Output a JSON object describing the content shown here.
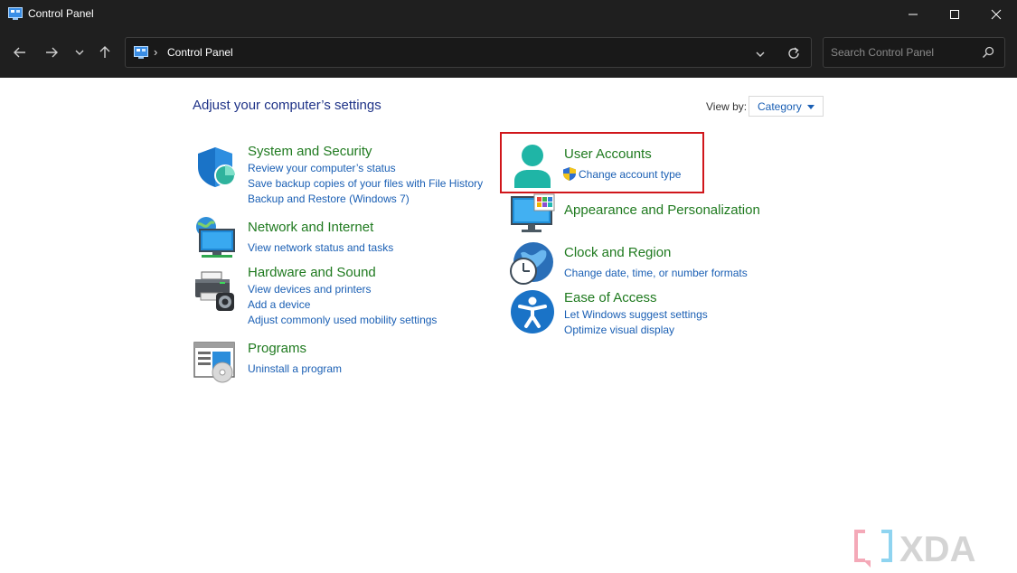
{
  "window": {
    "title": "Control Panel"
  },
  "navigation": {
    "address_separator": "›",
    "address_text": "Control Panel",
    "search_placeholder": "Search Control Panel"
  },
  "main": {
    "heading": "Adjust your computer’s settings",
    "view_by_label": "View by:",
    "view_by_value": "Category",
    "left_column": [
      {
        "title": "System and Security",
        "icon": "shield-icon",
        "links": [
          "Review your computer’s status",
          "Save backup copies of your files with File History",
          "Backup and Restore (Windows 7)"
        ]
      },
      {
        "title": "Network and Internet",
        "icon": "network-icon",
        "links": [
          "View network status and tasks"
        ]
      },
      {
        "title": "Hardware and Sound",
        "icon": "printer-icon",
        "links": [
          "View devices and printers",
          "Add a device",
          "Adjust commonly used mobility settings"
        ]
      },
      {
        "title": "Programs",
        "icon": "programs-icon",
        "links": [
          "Uninstall a program"
        ]
      }
    ],
    "right_column": [
      {
        "title": "User Accounts",
        "icon": "user-icon",
        "links": [
          "Change account type"
        ],
        "highlighted": true
      },
      {
        "title": "Appearance and Personalization",
        "icon": "monitor-icon",
        "links": []
      },
      {
        "title": "Clock and Region",
        "icon": "clock-globe-icon",
        "links": [
          "Change date, time, or number formats"
        ]
      },
      {
        "title": "Ease of Access",
        "icon": "accessibility-icon",
        "links": [
          "Let Windows suggest settings",
          "Optimize visual display"
        ]
      }
    ]
  },
  "watermark": {
    "text": "XDA"
  },
  "colors": {
    "titlebar": "#1f1f1f",
    "category_title": "#1f7a1f",
    "link": "#1a5fb4",
    "heading": "#1e3287",
    "highlight": "#d0161b"
  }
}
